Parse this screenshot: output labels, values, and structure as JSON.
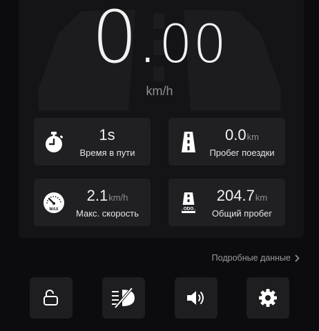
{
  "dashboard": {
    "speed_integer": "0",
    "speed_decimal": "00",
    "speed_unit": "km/h"
  },
  "stats": [
    {
      "value": "1s",
      "unit": "",
      "label": "Время в пути",
      "icon": "stopwatch-icon"
    },
    {
      "value": "0.0",
      "unit": "km",
      "label": "Пробег поездки",
      "icon": "road-icon"
    },
    {
      "value": "2.1",
      "unit": "km/h",
      "label": "Макс. скорость",
      "icon": "speedometer-max-icon",
      "icon_text": "MAX"
    },
    {
      "value": "204.7",
      "unit": "km",
      "label": "Общий пробег",
      "icon": "odometer-road-icon",
      "icon_text": "ODO"
    }
  ],
  "details_link": {
    "label": "Подробные данные"
  },
  "toolbar": {
    "lock": "unlock-icon",
    "lights": "headlight-off-icon",
    "sound": "speaker-icon",
    "settings": "gear-icon"
  },
  "colors": {
    "background": "#0c0c0e",
    "panel": "#141416",
    "card": "#202023",
    "text_secondary": "#8e8e93"
  }
}
